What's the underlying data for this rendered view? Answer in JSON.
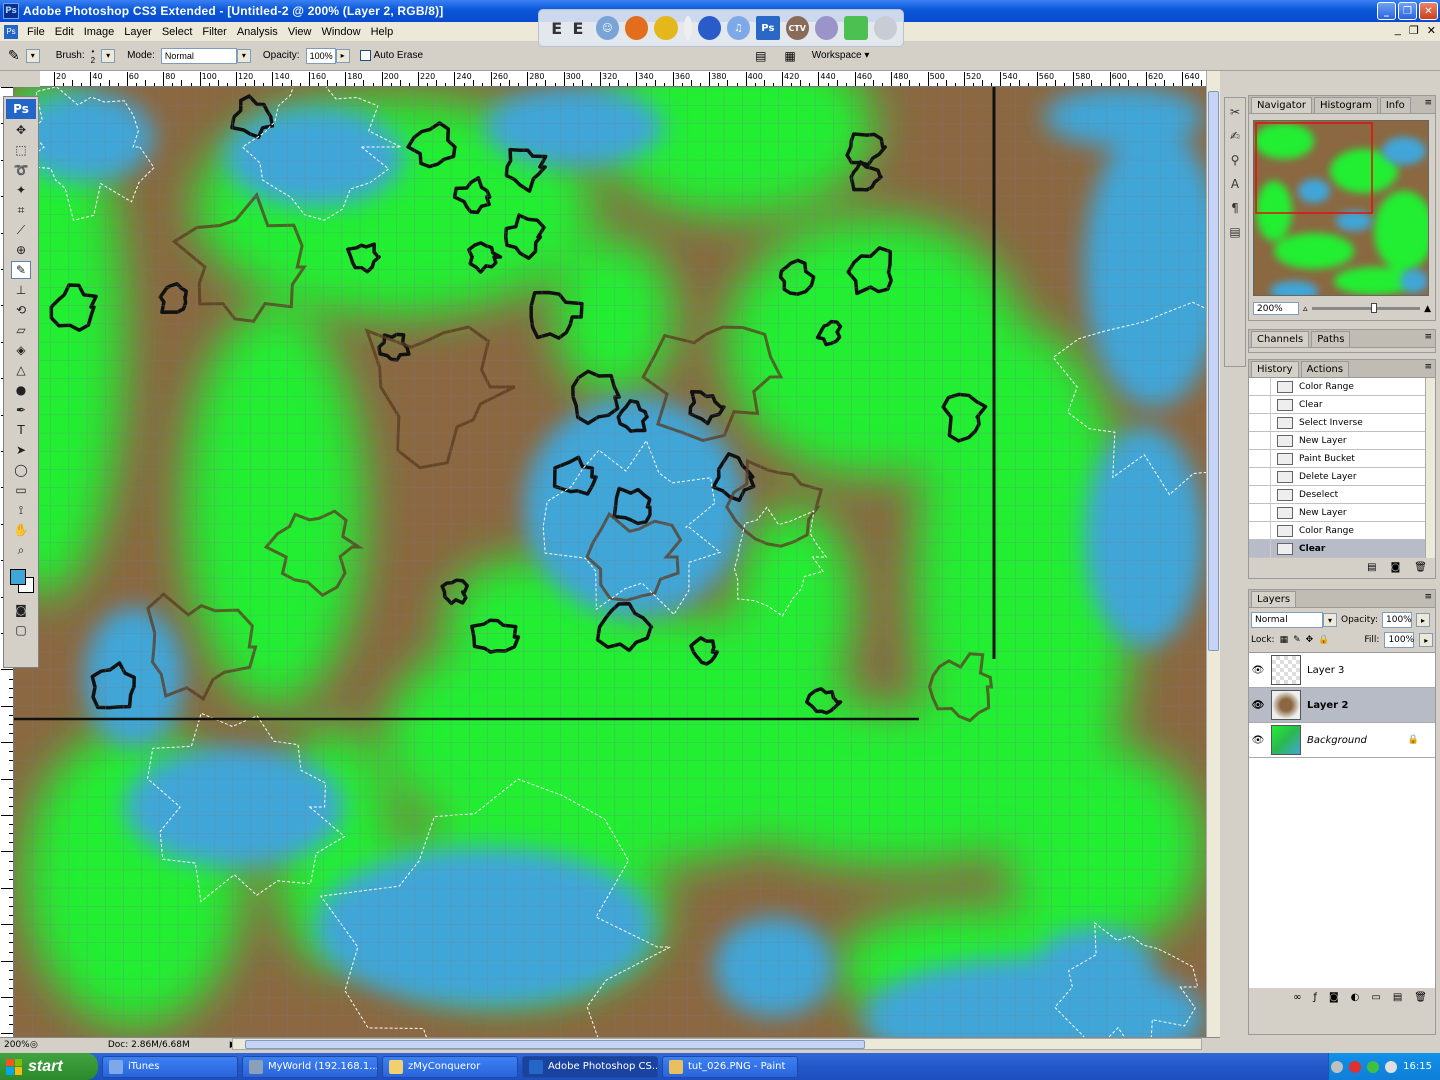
{
  "window": {
    "title": "Adobe Photoshop CS3 Extended - [Untitled-2 @ 200% (Layer 2, RGB/8)]",
    "app_icon": "Ps",
    "minimize": "_",
    "maximize": "❐",
    "close": "✕"
  },
  "quick_launch": {
    "icons": [
      "E",
      "E",
      "firefox-icon",
      "messenger-icon",
      "winamp-icon",
      "globe-icon",
      "itunes-icon",
      "photoshop-icon",
      "ctv-icon",
      "bar-icon",
      "key-icon",
      "recycle-icon"
    ],
    "ctv_label": "CTV",
    "ps_label": "Ps"
  },
  "menu": {
    "items": [
      "File",
      "Edit",
      "Image",
      "Layer",
      "Select",
      "Filter",
      "Analysis",
      "View",
      "Window",
      "Help"
    ],
    "doc_controls": [
      "_",
      "❐",
      "✕"
    ]
  },
  "options_bar": {
    "brush_label": "Brush:",
    "brush_size": "2",
    "mode_label": "Mode:",
    "mode_value": "Normal",
    "opacity_label": "Opacity:",
    "opacity_value": "100%",
    "auto_erase_label": "Auto Erase",
    "workspace_label": "Workspace"
  },
  "ruler": {
    "top_labels": [
      "20",
      "40",
      "60",
      "80",
      "100",
      "120",
      "140",
      "160",
      "180",
      "200",
      "220",
      "240",
      "260",
      "280",
      "300",
      "320",
      "340",
      "360",
      "380",
      "400",
      "420",
      "440",
      "460",
      "480",
      "500",
      "520",
      "540",
      "560",
      "580",
      "600",
      "620",
      "640"
    ]
  },
  "toolbox": {
    "logo": "Ps"
  },
  "status": {
    "zoom": "200%",
    "doc": "Doc: 2.86M/6.68M"
  },
  "panels": {
    "navigator": {
      "tabs": [
        "Navigator",
        "Histogram",
        "Info"
      ],
      "zoom": "200%"
    },
    "channels": {
      "tabs": [
        "Channels",
        "Paths"
      ]
    },
    "history": {
      "tabs": [
        "History",
        "Actions"
      ],
      "items": [
        "Color Range",
        "Clear",
        "Select Inverse",
        "New Layer",
        "Paint Bucket",
        "Delete Layer",
        "Deselect",
        "New Layer",
        "Color Range",
        "Clear"
      ],
      "selected_index": 9
    },
    "layers": {
      "tabs": [
        "Layers"
      ],
      "blend_mode": "Normal",
      "opacity_label": "Opacity:",
      "opacity_value": "100%",
      "lock_label": "Lock:",
      "fill_label": "Fill:",
      "fill_value": "100%",
      "items": [
        {
          "name": "Layer 3",
          "selected": false
        },
        {
          "name": "Layer 2",
          "selected": true
        },
        {
          "name": "Background",
          "selected": false,
          "locked": true
        }
      ]
    }
  },
  "taskbar": {
    "start": "start",
    "tasks": [
      "iTunes",
      "MyWorld (192.168.1....",
      "zMyConqueror",
      "Adobe Photoshop CS...",
      "tut_026.PNG - Paint"
    ],
    "active_task": 3,
    "clock": "16:15"
  },
  "colors": {
    "land": "#8b6841",
    "grass": "#22ee33",
    "water": "#3fa6d8",
    "xp_blue": "#245edb",
    "start_green": "#3a9a3a"
  }
}
